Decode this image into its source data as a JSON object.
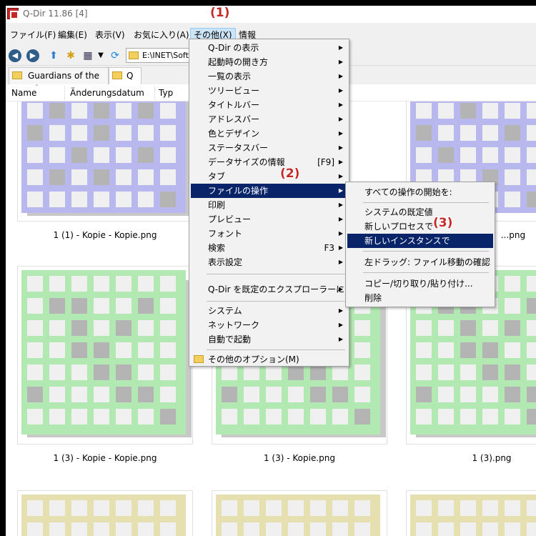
{
  "window": {
    "title": "Q-Dir 11.86 [4]"
  },
  "menubar": {
    "items": [
      {
        "label": "ファイル(F)"
      },
      {
        "label": "編集(E)"
      },
      {
        "label": "表示(V)"
      },
      {
        "label": "お気に入り(A)"
      },
      {
        "label": "その他(X)"
      },
      {
        "label": "情報"
      }
    ]
  },
  "toolbar": {
    "address": "E:\\INET\\Soft"
  },
  "tabs": [
    {
      "label": "Guardians of the ..."
    },
    {
      "label": "Q"
    }
  ],
  "columns": [
    "Name",
    "Änderungsdatum",
    "Typ"
  ],
  "files": [
    {
      "name": "1 (1) - Kopie - Kopie.png"
    },
    {
      "name": "...png"
    },
    {
      "name": "1 (3) - Kopie - Kopie.png"
    },
    {
      "name": "1 (3) - Kopie.png"
    },
    {
      "name": "1 (3).png"
    }
  ],
  "menu": {
    "items": [
      {
        "label": "Q-Dir の表示",
        "submenu": true
      },
      {
        "label": "起動時の開き方",
        "submenu": true
      },
      {
        "label": "一覧の表示",
        "submenu": true
      },
      {
        "label": "ツリービュー",
        "submenu": true
      },
      {
        "label": "タイトルバー",
        "submenu": true
      },
      {
        "label": "アドレスバー",
        "submenu": true
      },
      {
        "label": "色とデザイン",
        "submenu": true
      },
      {
        "label": "ステータスバー",
        "submenu": true
      },
      {
        "label": "データサイズの情報",
        "shortcut": "[F9]",
        "submenu": true
      },
      {
        "label": "タブ",
        "submenu": true
      },
      {
        "label": "ファイルの操作",
        "submenu": true,
        "highlighted": true
      },
      {
        "label": "印刷",
        "submenu": true
      },
      {
        "label": "プレビュー",
        "submenu": true
      },
      {
        "label": "フォント",
        "submenu": true
      },
      {
        "label": "検索",
        "shortcut": "F3",
        "submenu": true
      },
      {
        "label": "表示設定",
        "submenu": true
      },
      {
        "label": "Q-Dir を既定のエクスプローラーに",
        "submenu": true
      },
      {
        "label": "システム",
        "submenu": true
      },
      {
        "label": "ネットワーク",
        "submenu": true
      },
      {
        "label": "自動で起動",
        "submenu": true
      },
      {
        "label": "その他のオプション(M)",
        "icon": "folder-icon"
      }
    ]
  },
  "submenu": {
    "items": [
      {
        "label": "すべての操作の開始を:"
      },
      {
        "label": "システムの既定値"
      },
      {
        "label": "新しいプロセスで"
      },
      {
        "label": "新しいインスタンスで",
        "highlighted": true
      },
      {
        "label": "左ドラッグ: ファイル移動の確認"
      },
      {
        "label": "コピー/切り取り/貼り付け..."
      },
      {
        "label": "削除"
      }
    ]
  },
  "callouts": [
    "(1)",
    "(2)",
    "(3)"
  ],
  "colors": {
    "accent": "#c62828",
    "highlight": "#0a246a",
    "thumb_purple": "#b8b8ee",
    "thumb_green": "#b2e8b2",
    "thumb_yellow": "#e6e0b0"
  }
}
